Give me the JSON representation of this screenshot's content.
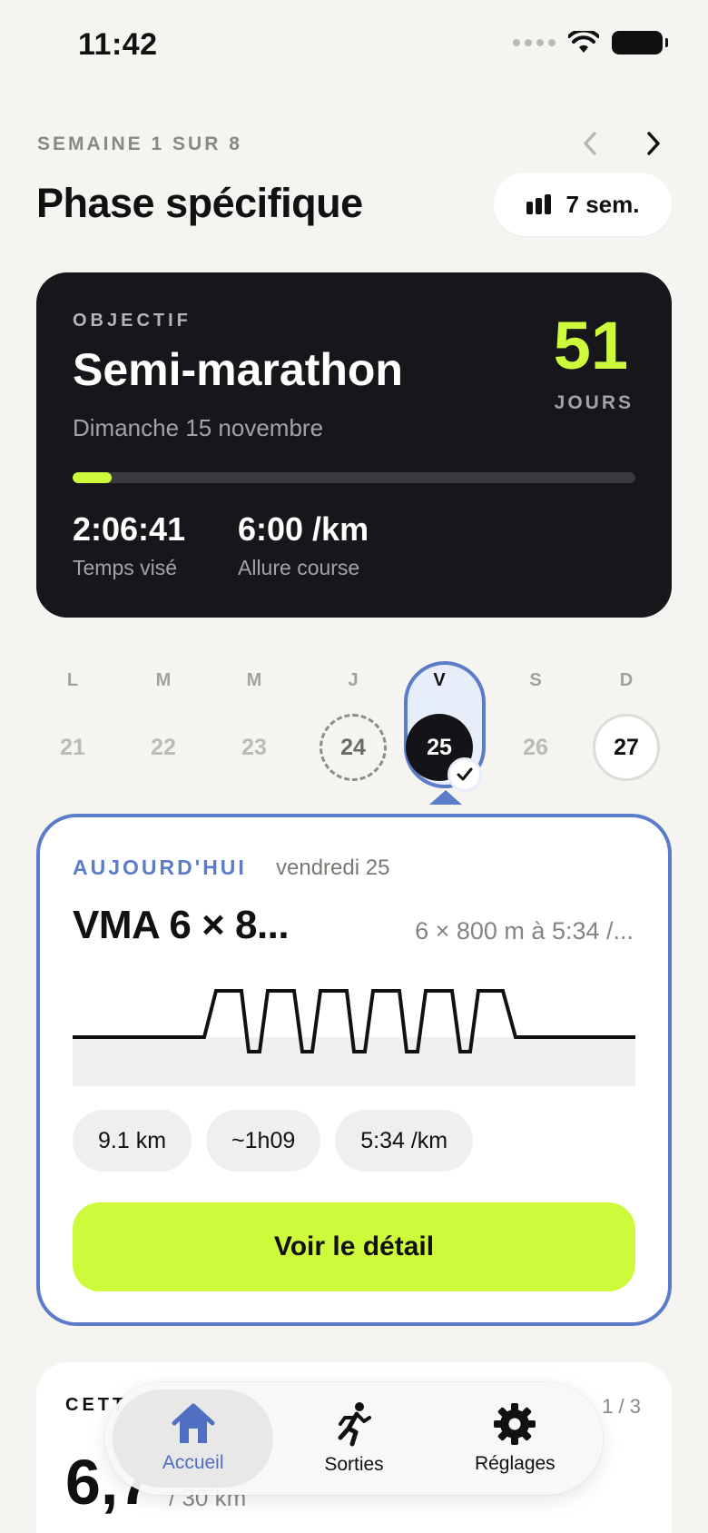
{
  "status_bar": {
    "time": "11:42"
  },
  "header": {
    "week_label": "SEMAINE 1 SUR 8",
    "title": "Phase spécifique",
    "weeks_pill": "7 sem."
  },
  "goal": {
    "eyebrow": "OBJECTIF",
    "race": "Semi-marathon",
    "date": "Dimanche 15 novembre",
    "days_remaining": "51",
    "days_label": "JOURS",
    "progress_fraction": 0.07,
    "stats": [
      {
        "value": "2:06:41",
        "label": "Temps visé"
      },
      {
        "value": "6:00 /km",
        "label": "Allure course"
      }
    ]
  },
  "week_days": [
    {
      "letter": "L",
      "num": "21",
      "state": "past"
    },
    {
      "letter": "M",
      "num": "22",
      "state": "past"
    },
    {
      "letter": "M",
      "num": "23",
      "state": "past"
    },
    {
      "letter": "J",
      "num": "24",
      "state": "dashed"
    },
    {
      "letter": "V",
      "num": "25",
      "state": "selected"
    },
    {
      "letter": "S",
      "num": "26",
      "state": "past"
    },
    {
      "letter": "D",
      "num": "27",
      "state": "outline"
    }
  ],
  "today": {
    "eyebrow": "AUJOURD'HUI",
    "date": "vendredi 25",
    "title": "VMA 6 × 8...",
    "subtitle": "6 × 800 m à 5:34 /...",
    "chips": [
      "9.1 km",
      "~1h09",
      "5:34 /km"
    ],
    "cta": "Voir le détail"
  },
  "week_summary": {
    "eyebrow": "CETT",
    "count": "1 / 3",
    "value": "6,7",
    "target": "/ 30 km"
  },
  "tabbar": [
    {
      "label": "Accueil",
      "icon": "home-icon",
      "active": true
    },
    {
      "label": "Sorties",
      "icon": "runner-icon",
      "active": false
    },
    {
      "label": "Réglages",
      "icon": "gear-icon",
      "active": false
    }
  ],
  "colors": {
    "accent_lime": "#cdfa3a",
    "accent_blue": "#5b7cc8",
    "dark_card": "#16161b",
    "background": "#f5f4f1"
  }
}
